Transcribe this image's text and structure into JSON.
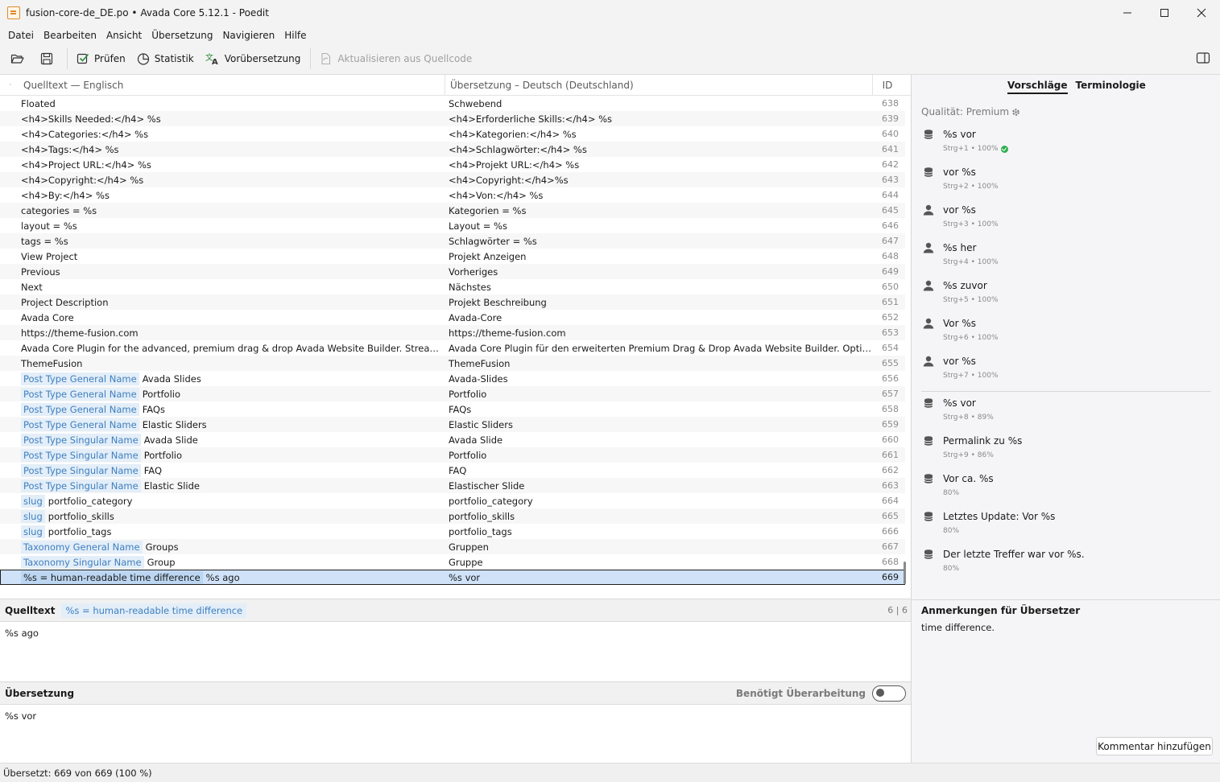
{
  "window": {
    "title": "fusion-core-de_DE.po • Avada Core 5.12.1 - Poedit",
    "minimize": "—",
    "maximize": "☐",
    "close": "✕"
  },
  "menu": [
    "Datei",
    "Bearbeiten",
    "Ansicht",
    "Übersetzung",
    "Navigieren",
    "Hilfe"
  ],
  "toolbar": {
    "validate": "Prüfen",
    "statistics": "Statistik",
    "pretranslate": "Vorübersetzung",
    "update": "Aktualisieren aus Quellcode"
  },
  "list": {
    "col_source": "Quelltext — Englisch",
    "col_translation": "Übersetzung – Deutsch (Deutschland)",
    "col_id": "ID",
    "dot": "·",
    "rows": [
      {
        "ctx": "",
        "src": "Floated",
        "tr": "Schwebend",
        "id": "638"
      },
      {
        "ctx": "",
        "src": "<h4>Skills Needed:</h4> %s",
        "tr": "<h4>Erforderliche Skills:</h4> %s",
        "id": "639"
      },
      {
        "ctx": "",
        "src": "<h4>Categories:</h4> %s",
        "tr": "<h4>Kategorien:</h4> %s",
        "id": "640"
      },
      {
        "ctx": "",
        "src": "<h4>Tags:</h4> %s",
        "tr": "<h4>Schlagwörter:</h4> %s",
        "id": "641"
      },
      {
        "ctx": "",
        "src": "<h4>Project URL:</h4> %s",
        "tr": "<h4>Projekt URL:</h4> %s",
        "id": "642"
      },
      {
        "ctx": "",
        "src": "<h4>Copyright:</h4> %s",
        "tr": "<h4>Copyright:</h4>%s",
        "id": "643"
      },
      {
        "ctx": "",
        "src": "<h4>By:</h4> %s",
        "tr": "<h4>Von:</h4> %s",
        "id": "644"
      },
      {
        "ctx": "",
        "src": "categories = %s",
        "tr": "Kategorien = %s",
        "id": "645"
      },
      {
        "ctx": "",
        "src": "layout = %s",
        "tr": "Layout = %s",
        "id": "646"
      },
      {
        "ctx": "",
        "src": "tags = %s",
        "tr": "Schlagwörter = %s",
        "id": "647"
      },
      {
        "ctx": "",
        "src": "View Project",
        "tr": "Projekt Anzeigen",
        "id": "648"
      },
      {
        "ctx": "",
        "src": "Previous",
        "tr": "Vorheriges",
        "id": "649"
      },
      {
        "ctx": "",
        "src": "Next",
        "tr": "Nächstes",
        "id": "650"
      },
      {
        "ctx": "",
        "src": "Project Description",
        "tr": "Projekt Beschreibung",
        "id": "651"
      },
      {
        "ctx": "",
        "src": "Avada Core",
        "tr": "Avada-Core",
        "id": "652"
      },
      {
        "ctx": "",
        "src": "https://theme-fusion.com",
        "tr": "https://theme-fusion.com",
        "id": "653"
      },
      {
        "ctx": "",
        "src": "Avada Core Plugin for the advanced, premium drag & drop Avada Website Builder. Streamline yo...",
        "tr": "Avada Core Plugin für den erweiterten Premium Drag & Drop Avada Website Builder. Optimieren ...",
        "id": "654"
      },
      {
        "ctx": "",
        "src": "ThemeFusion",
        "tr": "ThemeFusion",
        "id": "655"
      },
      {
        "ctx": "Post Type General Name",
        "src": "Avada Slides",
        "tr": "Avada-Slides",
        "id": "656"
      },
      {
        "ctx": "Post Type General Name",
        "src": "Portfolio",
        "tr": "Portfolio",
        "id": "657"
      },
      {
        "ctx": "Post Type General Name",
        "src": "FAQs",
        "tr": "FAQs",
        "id": "658"
      },
      {
        "ctx": "Post Type General Name",
        "src": "Elastic Sliders",
        "tr": "Elastic Sliders",
        "id": "659"
      },
      {
        "ctx": "Post Type Singular Name",
        "src": "Avada Slide",
        "tr": "Avada Slide",
        "id": "660"
      },
      {
        "ctx": "Post Type Singular Name",
        "src": "Portfolio",
        "tr": "Portfolio",
        "id": "661"
      },
      {
        "ctx": "Post Type Singular Name",
        "src": "FAQ",
        "tr": "FAQ",
        "id": "662"
      },
      {
        "ctx": "Post Type Singular Name",
        "src": "Elastic Slide",
        "tr": "Elastischer Slide",
        "id": "663"
      },
      {
        "ctx": "slug",
        "src": "portfolio_category",
        "tr": "portfolio_category",
        "id": "664"
      },
      {
        "ctx": "slug",
        "src": "portfolio_skills",
        "tr": "portfolio_skills",
        "id": "665"
      },
      {
        "ctx": "slug",
        "src": "portfolio_tags",
        "tr": "portfolio_tags",
        "id": "666"
      },
      {
        "ctx": "Taxonomy General Name",
        "src": "Groups",
        "tr": "Gruppen",
        "id": "667"
      },
      {
        "ctx": "Taxonomy Singular Name",
        "src": "Group",
        "tr": "Gruppe",
        "id": "668"
      },
      {
        "ctx": "%s = human-readable time difference",
        "src": "%s ago",
        "tr": "%s vor",
        "id": "669",
        "selected": true
      }
    ]
  },
  "source_panel": {
    "title": "Quelltext",
    "context": "%s = human-readable time difference",
    "count": "6 | 6",
    "text": "%s ago"
  },
  "translation_panel": {
    "title": "Übersetzung",
    "needs_work": "Benötigt Überarbeitung",
    "text": "%s vor"
  },
  "status": "Übersetzt: 669 von 669 (100 %)",
  "sidebar": {
    "tab_suggestions": "Vorschläge",
    "tab_terminology": "Terminologie",
    "quality": "Qualität: Premium",
    "suggestions": [
      {
        "icon": "database-icon",
        "text": "%s vor",
        "meta": "Strg+1 • 100%",
        "verified": true
      },
      {
        "icon": "database-icon",
        "text": "vor %s",
        "meta": "Strg+2 • 100%"
      },
      {
        "icon": "person-icon",
        "text": "vor %s",
        "meta": "Strg+3 • 100%"
      },
      {
        "icon": "person-icon",
        "text": "%s her",
        "meta": "Strg+4 • 100%"
      },
      {
        "icon": "person-icon",
        "text": "%s zuvor",
        "meta": "Strg+5 • 100%"
      },
      {
        "icon": "person-icon",
        "text": "Vor %s",
        "meta": "Strg+6 • 100%"
      },
      {
        "icon": "person-icon",
        "text": "vor %s",
        "meta": "Strg+7 • 100%"
      },
      {
        "icon": "database-icon",
        "text": "%s vor",
        "meta": "Strg+8 • 89%"
      },
      {
        "icon": "database-icon",
        "text": "Permalink zu %s",
        "meta": "Strg+9 • 86%"
      },
      {
        "icon": "database-icon",
        "text": "Vor ca. %s",
        "meta": "80%"
      },
      {
        "icon": "database-icon",
        "text": "Letztes Update: Vor %s",
        "meta": "80%"
      },
      {
        "icon": "database-icon",
        "text": "Der letzte Treffer war vor %s.",
        "meta": "80%"
      }
    ],
    "notes_title": "Anmerkungen für Übersetzer",
    "notes_text": "time difference.",
    "add_comment": "Kommentar hinzufügen"
  },
  "colors": {
    "context_bg": "#e3eef8",
    "context_text": "#3f7fbf",
    "selected_row": "#cfe2f8",
    "verified": "#2eae4e"
  }
}
